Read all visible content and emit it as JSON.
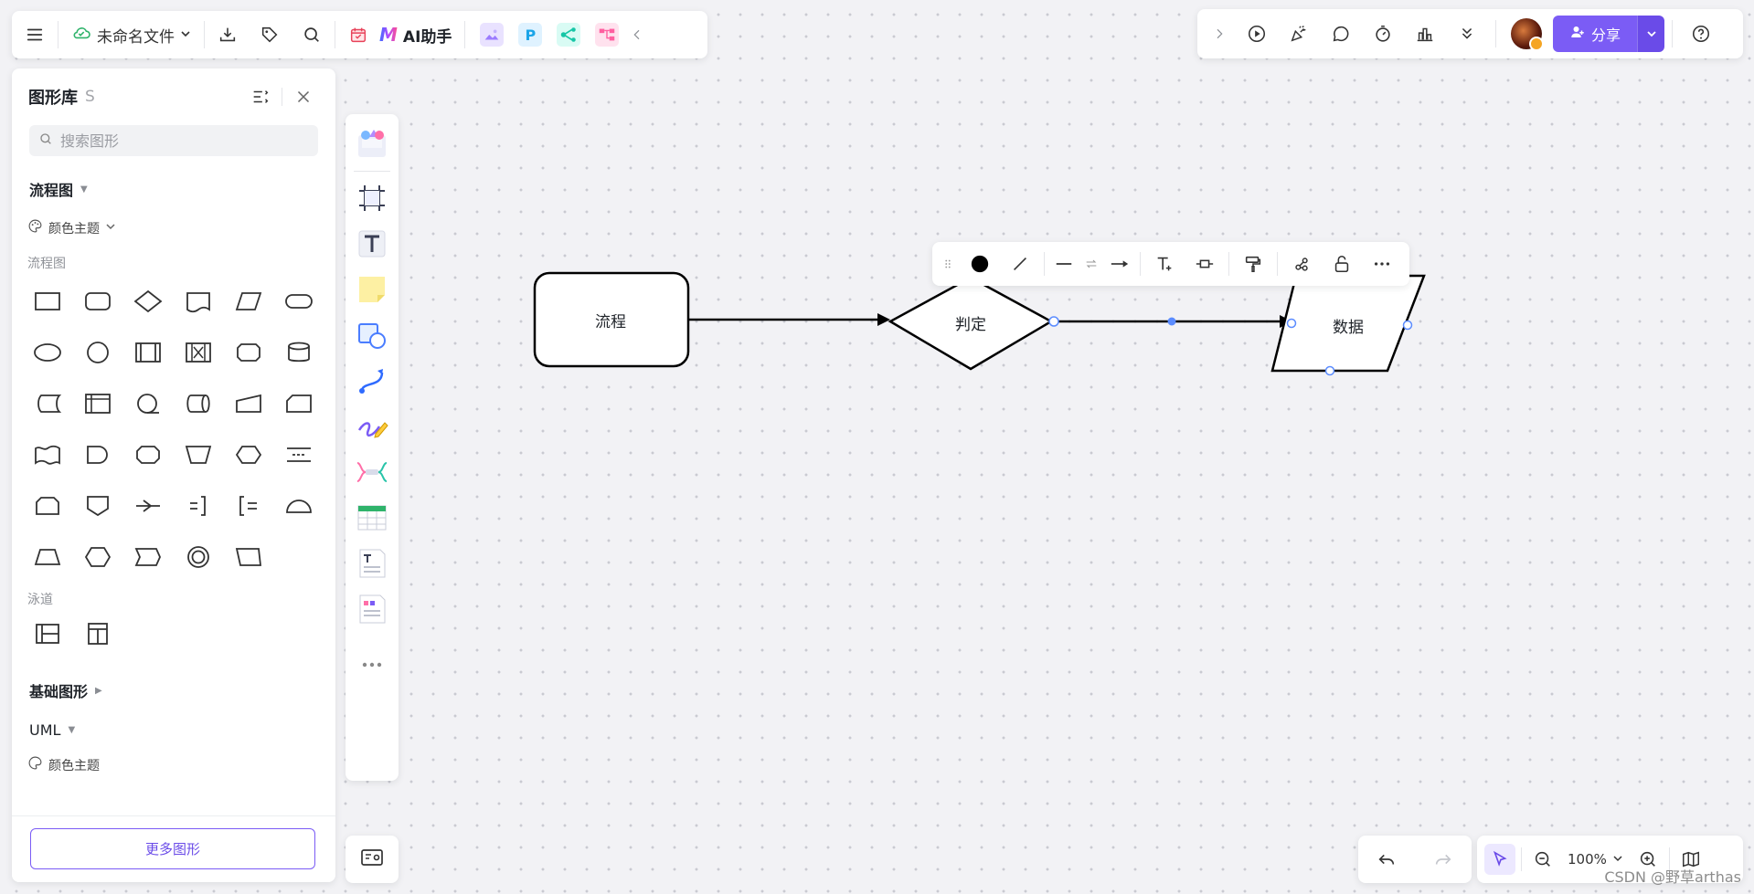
{
  "file": {
    "name": "未命名文件"
  },
  "toolbar": {
    "ai_label": "AI助手",
    "ai_logo": "M",
    "plugin_p": "P"
  },
  "topright": {
    "share_label": "分享"
  },
  "library": {
    "title": "图形库",
    "shortcut": "S",
    "search_placeholder": "搜索图形",
    "section_flow": "流程图",
    "theme_label": "颜色主题",
    "category_flow": "流程图",
    "category_lane": "泳道",
    "section_basic": "基础图形",
    "section_uml": "UML",
    "theme_label_2": "颜色主题",
    "more_button": "更多图形"
  },
  "canvas": {
    "nodes": [
      {
        "label": "流程"
      },
      {
        "label": "判定"
      },
      {
        "label": "数据"
      }
    ]
  },
  "zoom": {
    "value": "100%"
  },
  "watermark": "CSDN @野草arthas",
  "colors": {
    "accent": "#7b5cf5",
    "canvas_bg": "#f2f2f5",
    "handle": "#5b8cff"
  }
}
